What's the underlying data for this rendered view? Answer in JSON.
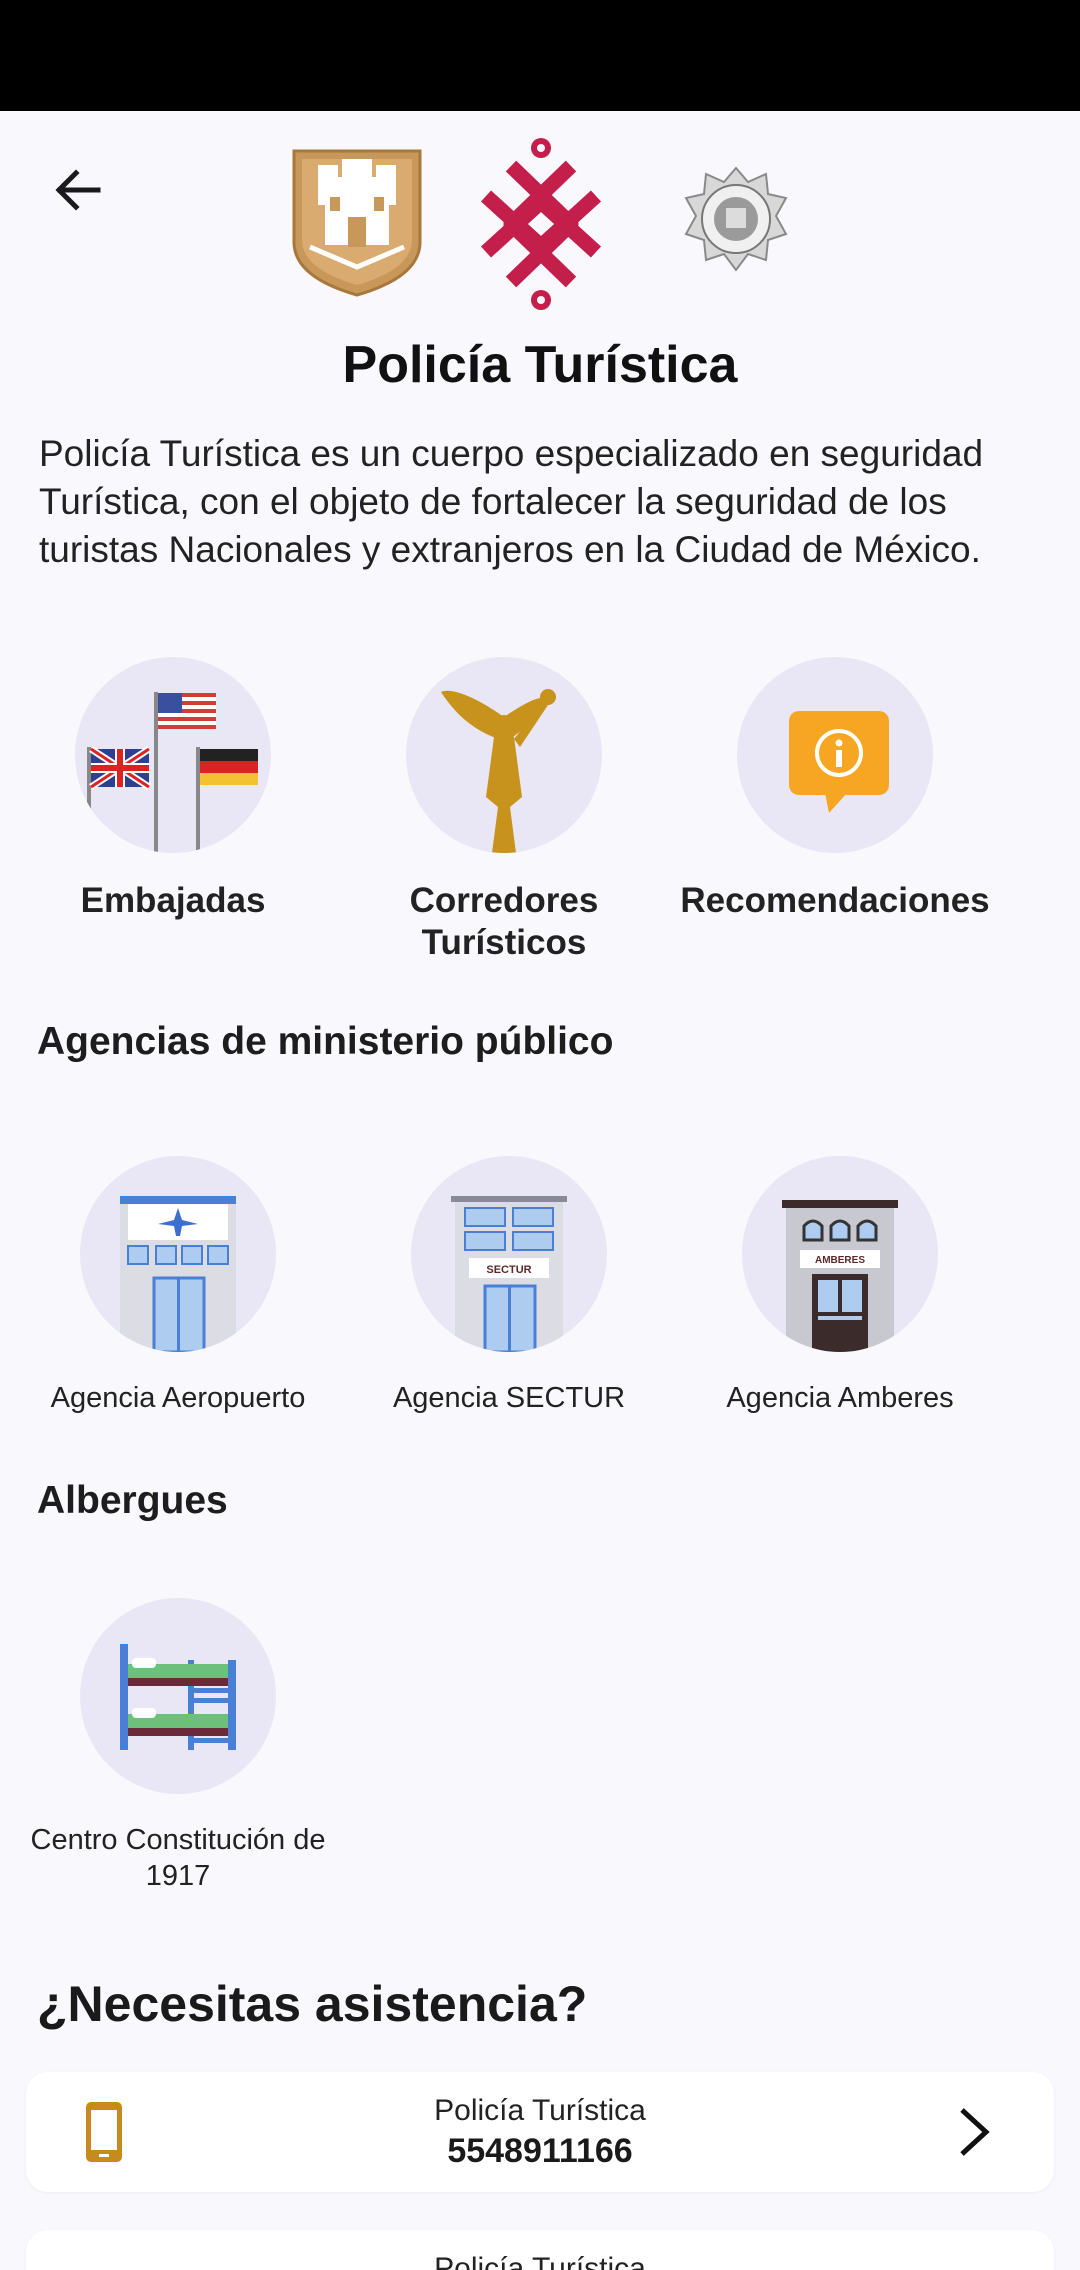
{
  "header": {
    "title": "Policía Turística",
    "description": "Policía Turística es un cuerpo especializado en seguridad Turística, con el objeto de fortalecer la seguridad de los turistas Nacionales y extranjeros en la Ciudad de México."
  },
  "categories": [
    {
      "label": "Embajadas",
      "icon": "flags-icon"
    },
    {
      "label": "Corredores Turísticos",
      "icon": "angel-statue-icon"
    },
    {
      "label": "Recomendaciones",
      "icon": "info-bubble-icon"
    }
  ],
  "agencies": {
    "title": "Agencias de ministerio público",
    "items": [
      {
        "label": "Agencia Aeropuerto",
        "icon": "airport-building-icon"
      },
      {
        "label": "Agencia SECTUR",
        "icon": "sectur-building-icon",
        "sign": "SECTUR"
      },
      {
        "label": "Agencia Amberes",
        "icon": "amberes-building-icon",
        "sign": "AMBERES"
      }
    ]
  },
  "shelters": {
    "title": "Albergues",
    "items": [
      {
        "label": "Centro Constitución de 1917",
        "icon": "bunk-bed-icon"
      }
    ]
  },
  "assistance": {
    "title": "¿Necesitas asistencia?",
    "cards": [
      {
        "name": "Policía Turística",
        "number": "5548911166"
      },
      {
        "name": "Policía Turística",
        "number": ""
      }
    ]
  },
  "colors": {
    "gold": "#c8975a",
    "crimson": "#c41f4a",
    "icon_gold": "#c68a1d",
    "circle_bg": "#e9e7f5"
  }
}
